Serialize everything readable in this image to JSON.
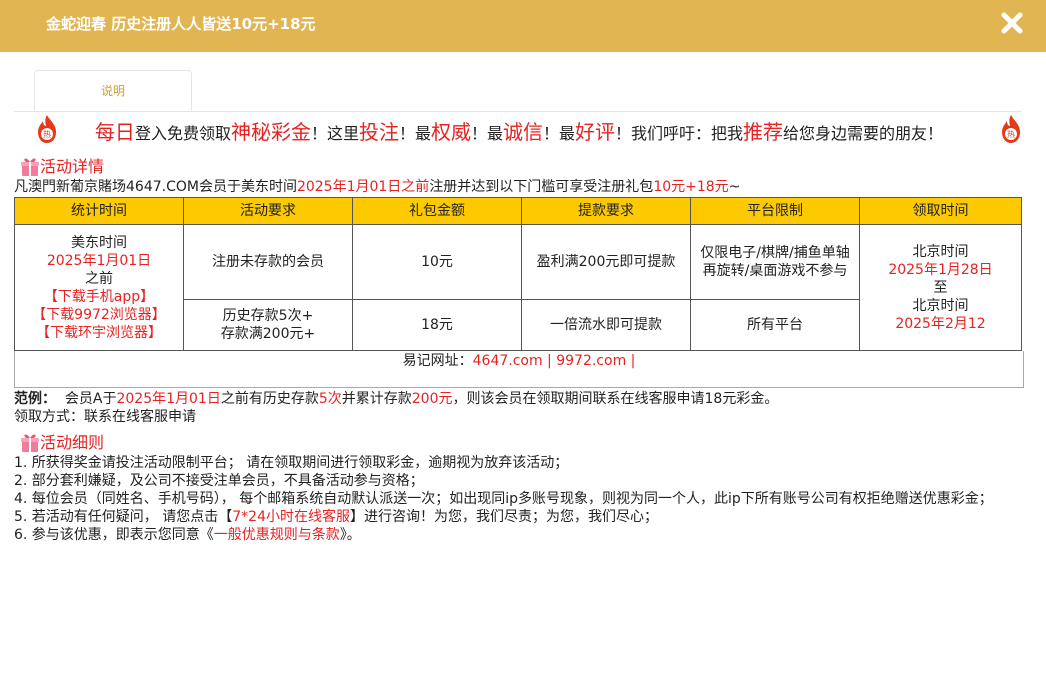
{
  "header": {
    "title": "金蛇迎春 历史注册人人皆送10元+18元"
  },
  "tabs": [
    {
      "label": "说明"
    }
  ],
  "slogan": {
    "t1": "每日",
    "t2": "登入免费领取",
    "t3": "神秘彩金",
    "t4": "！这里",
    "t5": "投注",
    "t6": "！最",
    "t7": "权威",
    "t8": "！最",
    "t9": "诚信",
    "t10": "！最",
    "t11": "好评",
    "t12": "！我们呼吁：把我",
    "t13": "推荐",
    "t14": "给您身边需要的朋友！"
  },
  "details": {
    "heading": "活动详情",
    "intro": {
      "p1": "凡澳門新葡京賭场4647.COM会员于美东时间",
      "p2": "2025年1月01日之前",
      "p3": "注册并达到以下门槛可享受注册礼包",
      "p4": "10元+18元",
      "p5": "~"
    }
  },
  "table": {
    "headers": [
      "统计时间",
      "活动要求",
      "礼包金额",
      "提款要求",
      "平台限制",
      "领取时间"
    ],
    "stat": {
      "l1": "美东时间",
      "l2": "2025年1月01日",
      "l3": "之前",
      "l4": "【下载手机app】",
      "l5": "【下载9972浏览器】",
      "l6": "【下载环宇浏览器】"
    },
    "rows": [
      {
        "req": "注册未存款的会员",
        "amount": "10元",
        "withdraw": "盈利满200元即可提款",
        "platform": "仅限电子/棋牌/捕鱼单轴再旋转/桌面游戏不参与"
      },
      {
        "req_l1": "历史存款5次+",
        "req_l2": "存款满200元+",
        "amount": "18元",
        "withdraw": "一倍流水即可提款",
        "platform": "所有平台"
      }
    ],
    "claim": {
      "l1": "北京时间",
      "l2": "2025年1月28日",
      "l3": "至",
      "l4": "北京时间",
      "l5": "2025年2月12"
    },
    "url": {
      "label": "易记网址：",
      "links": "4647.com | 9972.com |"
    }
  },
  "example": {
    "label": "范例：",
    "p1": "会员A于",
    "p2": "2025年1月01日",
    "p3": "之前有历史存款",
    "p4": "5次",
    "p5": "并累计存款",
    "p6": "200元",
    "p7": "，则该会员在领取期间联系在线客服申请18元彩金。"
  },
  "method": "领取方式：联系在线客服申请",
  "rules": {
    "heading": "活动细则",
    "r1": "1. 所获得奖金请投注活动限制平台；  请在领取期间进行领取彩金，逾期视为放弃该活动；",
    "r2": "2. 部分套利嫌疑，及公司不接受注单会员，不具备活动参与资格；",
    "r4": "4. 每位会员（同姓名、手机号码），  每个邮箱系统自动默认派送一次；如出现同ip多账号现象，则视为同一个人，此ip下所有账号公司有权拒绝赠送优惠彩金；",
    "r5a": "5. 若活动有任何疑问，  请您点击【",
    "r5b": "7*24小时在线客服",
    "r5c": "】进行咨询！为您，我们尽责；为您，我们尽心；",
    "r6a": "6. 参与该优惠，即表示您同意《",
    "r6b": "一般优惠规则与条款",
    "r6c": "》。"
  },
  "colors": {
    "header_bg": "#e2b553",
    "table_header_bg": "#fdc901",
    "accent_red": "#e62222",
    "tab_text": "#d49f2a"
  }
}
